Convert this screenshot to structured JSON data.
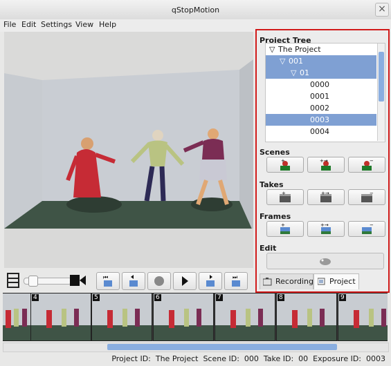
{
  "window": {
    "title": "qStopMotion",
    "close_glyph": "×"
  },
  "menu": [
    "File",
    "Edit",
    "Settings",
    "View",
    "Help"
  ],
  "project_panel": {
    "project_tree_label": "Project Tree",
    "tree": [
      {
        "label": "The Project",
        "expanded": true,
        "selected": false
      },
      {
        "label": "001",
        "expanded": true,
        "selected": true
      },
      {
        "label": "01",
        "expanded": true,
        "selected": true
      },
      {
        "label": "0000",
        "selected": false
      },
      {
        "label": "0001",
        "selected": false
      },
      {
        "label": "0002",
        "selected": false
      },
      {
        "label": "0003",
        "selected": true
      },
      {
        "label": "0004",
        "selected": false
      }
    ],
    "scenes_label": "Scenes",
    "takes_label": "Takes",
    "frames_label": "Frames",
    "edit_label": "Edit",
    "tabs": {
      "recording": "Recording",
      "project": "Project"
    }
  },
  "filmstrip": {
    "frame_numbers": [
      "4",
      "5",
      "6",
      "7",
      "8",
      "9"
    ]
  },
  "status": {
    "text": "Project ID:  The Project  Scene ID:  000  Take ID:  00  Exposure ID:  0003"
  },
  "colors": {
    "selection": "#7fa0d3",
    "highlight_border": "#d11a1a",
    "scrollbar": "#8aaee0"
  }
}
